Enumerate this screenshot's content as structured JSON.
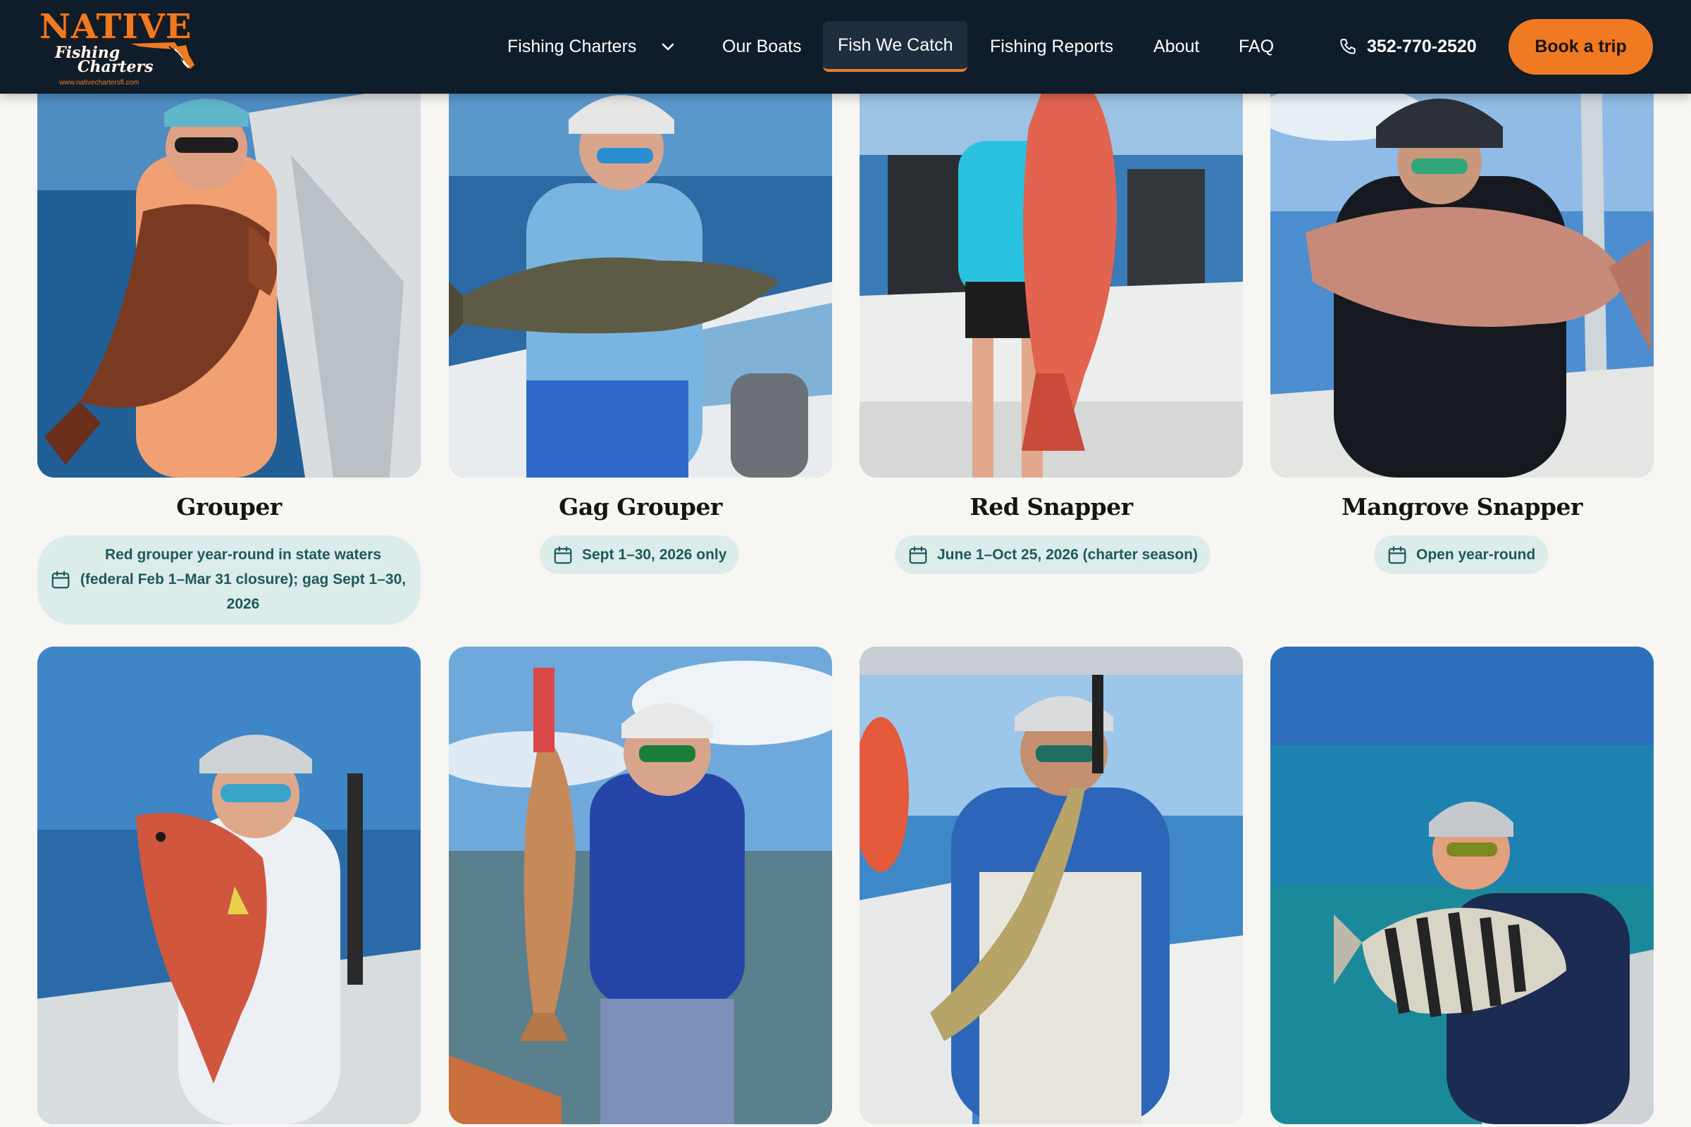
{
  "header": {
    "logo": {
      "title": "NATIVE",
      "line2": "Fishing",
      "line3": "Charters",
      "url": "www.nativechartersfl.com"
    },
    "nav": [
      {
        "label": "Fishing Charters",
        "has_dropdown": true,
        "active": false
      },
      {
        "label": "Our Boats",
        "active": false
      },
      {
        "label": "Fish We Catch",
        "active": true
      },
      {
        "label": "Fishing Reports",
        "active": false
      },
      {
        "label": "About",
        "active": false
      },
      {
        "label": "FAQ",
        "active": false
      }
    ],
    "phone": "352-770-2520",
    "cta": "Book a trip"
  },
  "colors": {
    "header_bg": "#0f1c2a",
    "accent": "#f07a22",
    "pill_bg": "#dcecea",
    "pill_text": "#1c5a5c",
    "page_bg": "#f7f6f2"
  },
  "fish": [
    {
      "name": "Grouper",
      "season": "Red grouper year-round in state waters (federal Feb 1–Mar 31 closure); gag Sept 1–30, 2026",
      "icon": "calendar-icon"
    },
    {
      "name": "Gag Grouper",
      "season": "Sept 1–30, 2026 only",
      "icon": "calendar-icon"
    },
    {
      "name": "Red Snapper",
      "season": "June 1–Oct 25, 2026 (charter season)",
      "icon": "calendar-icon"
    },
    {
      "name": "Mangrove Snapper",
      "season": "Open year-round",
      "icon": "calendar-icon"
    }
  ]
}
